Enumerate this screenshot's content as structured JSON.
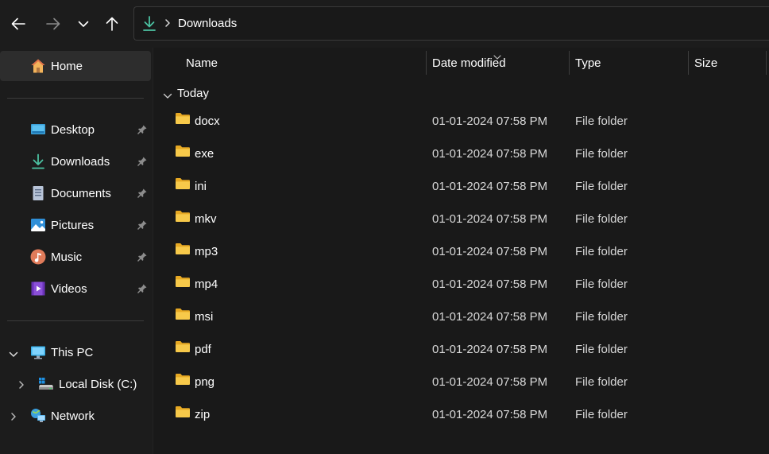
{
  "toolbar": {
    "back_icon": "arrow-left-icon",
    "forward_icon": "arrow-right-icon",
    "recent_icon": "chevron-down-icon",
    "up_icon": "arrow-up-icon"
  },
  "address": {
    "icon": "downloads-icon",
    "separator_icon": "chevron-right-icon",
    "crumb": "Downloads"
  },
  "sidebar": {
    "home": {
      "label": "Home",
      "icon": "home-icon"
    },
    "quick_access": [
      {
        "label": "Desktop",
        "icon": "desktop-icon",
        "pinned": true
      },
      {
        "label": "Downloads",
        "icon": "downloads-icon",
        "pinned": true
      },
      {
        "label": "Documents",
        "icon": "documents-icon",
        "pinned": true
      },
      {
        "label": "Pictures",
        "icon": "pictures-icon",
        "pinned": true
      },
      {
        "label": "Music",
        "icon": "music-icon",
        "pinned": true
      },
      {
        "label": "Videos",
        "icon": "videos-icon",
        "pinned": true
      }
    ],
    "this_pc": {
      "label": "This PC",
      "icon": "this-pc-icon",
      "expanded": true
    },
    "local_disk": {
      "label": "Local Disk (C:)",
      "icon": "drive-icon"
    },
    "network": {
      "label": "Network",
      "icon": "network-icon"
    }
  },
  "columns": {
    "name": "Name",
    "date_modified": "Date modified",
    "type": "Type",
    "size": "Size"
  },
  "group": {
    "label": "Today",
    "expanded": true
  },
  "files": [
    {
      "name": "docx",
      "date": "01-01-2024 07:58 PM",
      "type": "File folder"
    },
    {
      "name": "exe",
      "date": "01-01-2024 07:58 PM",
      "type": "File folder"
    },
    {
      "name": "ini",
      "date": "01-01-2024 07:58 PM",
      "type": "File folder"
    },
    {
      "name": "mkv",
      "date": "01-01-2024 07:58 PM",
      "type": "File folder"
    },
    {
      "name": "mp3",
      "date": "01-01-2024 07:58 PM",
      "type": "File folder"
    },
    {
      "name": "mp4",
      "date": "01-01-2024 07:58 PM",
      "type": "File folder"
    },
    {
      "name": "msi",
      "date": "01-01-2024 07:58 PM",
      "type": "File folder"
    },
    {
      "name": "pdf",
      "date": "01-01-2024 07:58 PM",
      "type": "File folder"
    },
    {
      "name": "png",
      "date": "01-01-2024 07:58 PM",
      "type": "File folder"
    },
    {
      "name": "zip",
      "date": "01-01-2024 07:58 PM",
      "type": "File folder"
    }
  ],
  "colors": {
    "background": "#191919",
    "sidebar_selected": "#2d2d2d",
    "folder": "#f4c43e",
    "accent_download": "#4cc2a2"
  }
}
